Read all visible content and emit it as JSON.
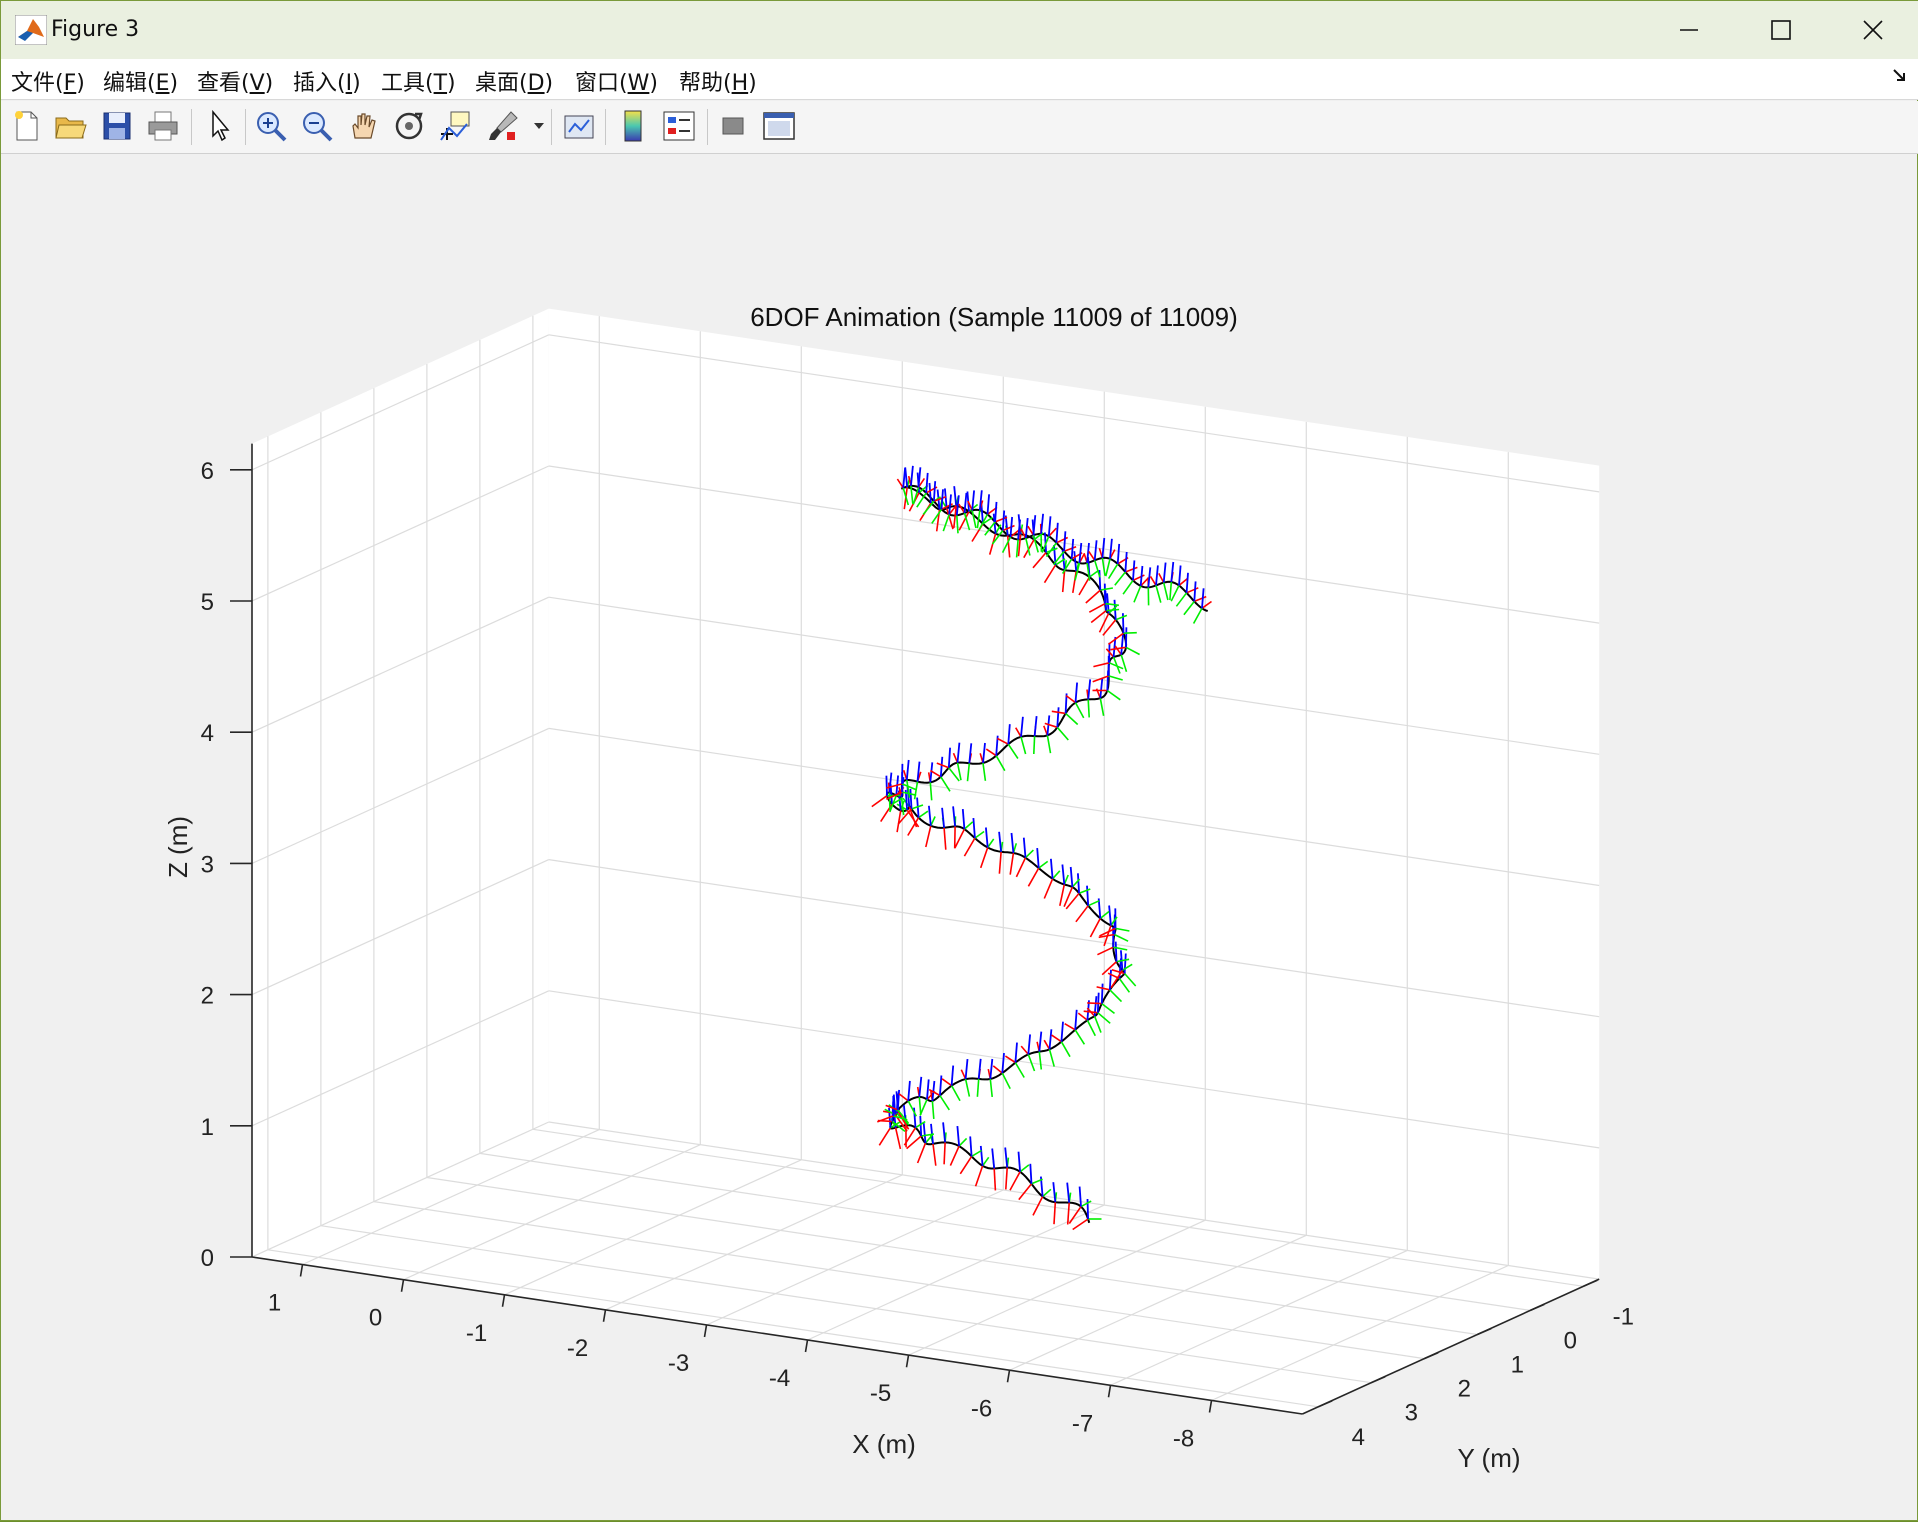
{
  "window": {
    "title": "Figure 3",
    "minimize_label": "─",
    "maximize_label": "☐",
    "close_label": "✕"
  },
  "menubar": {
    "items": [
      {
        "text": "文件(",
        "mn": "F",
        "close": ")"
      },
      {
        "text": "编辑(",
        "mn": "E",
        "close": ")"
      },
      {
        "text": "查看(",
        "mn": "V",
        "close": ")"
      },
      {
        "text": "插入(",
        "mn": "I",
        "close": ")"
      },
      {
        "text": "工具(",
        "mn": "T",
        "close": ")"
      },
      {
        "text": "桌面(",
        "mn": "D",
        "close": ")"
      },
      {
        "text": "窗口(",
        "mn": "W",
        "close": ")"
      },
      {
        "text": "帮助(",
        "mn": "H",
        "close": ")"
      }
    ]
  },
  "toolbar": {
    "icons": [
      "new-figure-icon",
      "open-file-icon",
      "save-icon",
      "print-icon",
      "select-arrow-icon",
      "zoom-in-icon",
      "zoom-out-icon",
      "pan-hand-icon",
      "rotate-3d-icon",
      "data-cursor-icon",
      "brush-icon",
      "link-plot-icon",
      "colorbar-icon",
      "legend-icon",
      "hide-plot-tools-icon",
      "show-plot-tools-icon"
    ]
  },
  "chart_data": {
    "type": "line",
    "title": "6DOF Animation (Sample 11009 of 11009)",
    "xlabel": "X (m)",
    "ylabel": "Y (m)",
    "zlabel": "Z (m)",
    "xlim": [
      -8.9,
      1.5
    ],
    "ylim": [
      -1.3,
      4.3
    ],
    "zlim": [
      0,
      6.2
    ],
    "x_ticks": [
      1,
      0,
      -1,
      -2,
      -3,
      -4,
      -5,
      -6,
      -7,
      -8
    ],
    "y_ticks": [
      -1,
      0,
      1,
      2,
      3,
      4
    ],
    "z_ticks": [
      0,
      1,
      2,
      3,
      4,
      5,
      6
    ],
    "grid": true,
    "series_colors": {
      "path": "#000000",
      "x_axis_arrows": "#ff0000",
      "y_axis_arrows": "#00ee00",
      "z_axis_arrows": "#0000ff"
    },
    "trajectory": {
      "helix_center_xy": [
        -4.5,
        1.5
      ],
      "helix_radius": 1.0,
      "helix_turns": 2.3,
      "helix_z_range": [
        0.3,
        5.9
      ],
      "end_point": [
        -7.7,
        3.8,
        5.95
      ]
    }
  }
}
